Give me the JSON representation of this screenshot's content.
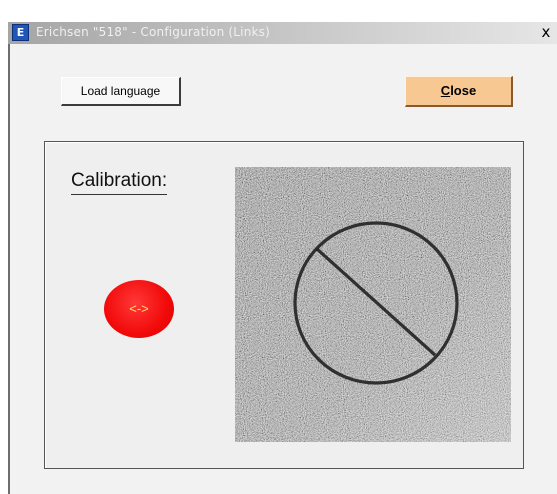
{
  "window": {
    "title": "Erichsen \"518\" - Configuration (Links)",
    "app_icon_glyph": "E",
    "close_glyph": "x"
  },
  "toolbar": {
    "load_language_label": "Load language",
    "close_label_first": "C",
    "close_label_rest": "lose"
  },
  "calibration": {
    "label": "Calibration:",
    "button_label": "<->",
    "button_color": "#f20a0a",
    "image_icon": "textured-surface-with-prohibition-circle"
  },
  "colors": {
    "close_button_bg": "#f8c892",
    "window_bg": "#f2f2f2"
  }
}
